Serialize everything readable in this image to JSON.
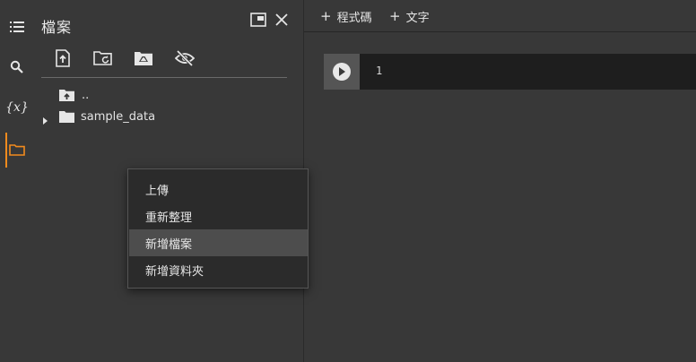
{
  "activity_bar": {
    "items": [
      {
        "name": "table-of-contents",
        "icon": "list-icon"
      },
      {
        "name": "search",
        "icon": "search-icon"
      },
      {
        "name": "variables",
        "icon": "variables-icon",
        "label": "{x}"
      },
      {
        "name": "files",
        "icon": "folder-icon",
        "active": true
      }
    ],
    "active_color": "#f28b1d"
  },
  "file_panel": {
    "title": "檔案",
    "toolbar": [
      {
        "name": "upload-file",
        "icon": "file-upload-icon"
      },
      {
        "name": "refresh",
        "icon": "folder-refresh-icon"
      },
      {
        "name": "mount-drive",
        "icon": "drive-icon"
      },
      {
        "name": "toggle-hidden",
        "icon": "eye-off-icon"
      }
    ],
    "tree": [
      {
        "label": "..",
        "icon": "folder-up-icon"
      },
      {
        "label": "sample_data",
        "icon": "folder-icon",
        "collapsed": true
      }
    ]
  },
  "header": {
    "add_code_label": "程式碼",
    "add_text_label": "文字",
    "plus": "+"
  },
  "cell": {
    "line_number": "1"
  },
  "context_menu": {
    "items": [
      {
        "label": "上傳",
        "hovered": false
      },
      {
        "label": "重新整理",
        "hovered": false
      },
      {
        "label": "新增檔案",
        "hovered": true
      },
      {
        "label": "新增資料夾",
        "hovered": false
      }
    ]
  }
}
